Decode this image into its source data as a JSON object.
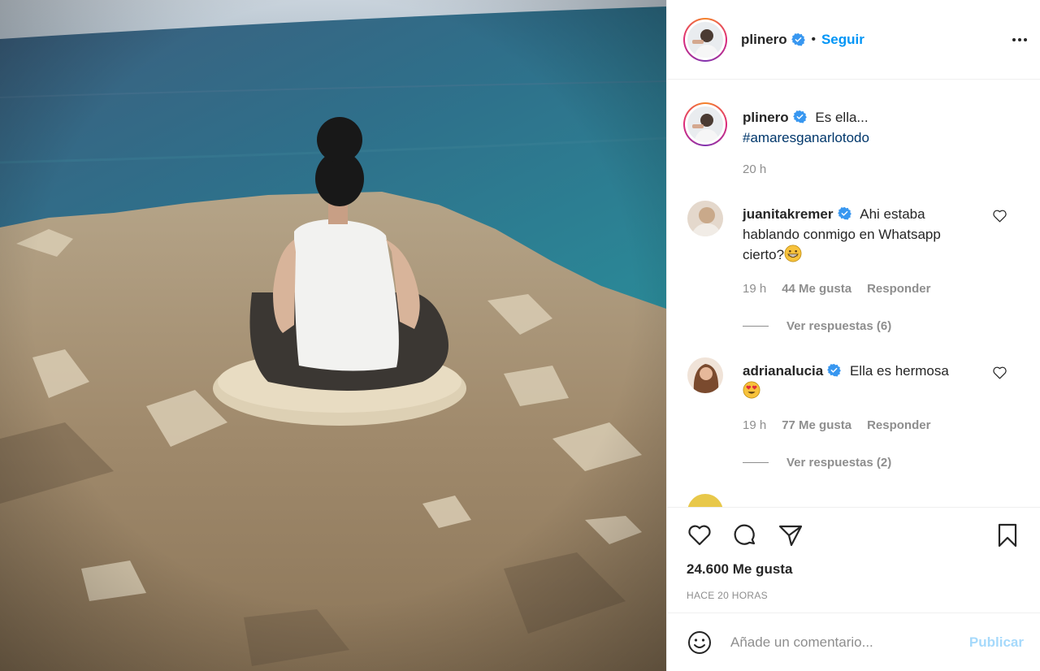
{
  "header": {
    "username": "plinero",
    "separator": "•",
    "follow_label": "Seguir",
    "more_icon": "more-horizontal-icon"
  },
  "caption": {
    "username": "plinero",
    "text": "Es ella...",
    "hashtag": "#amaresganarlotodo",
    "time": "20 h"
  },
  "comments": [
    {
      "username": "juanitakremer",
      "text": "Ahi estaba hablando conmigo en Whatsapp cierto?",
      "emoji_icon": "grinning-face-emoji",
      "time": "19 h",
      "likes": "44 Me gusta",
      "reply_label": "Responder",
      "view_replies": "Ver respuestas (6)"
    },
    {
      "username": "adrianalucia",
      "text": "Ella es hermosa",
      "emoji_icon": "heart-eyes-emoji",
      "time": "19 h",
      "likes": "77 Me gusta",
      "reply_label": "Responder",
      "view_replies": "Ver respuestas (2)"
    }
  ],
  "actions": {
    "like_icon": "heart-icon",
    "comment_icon": "comment-icon",
    "share_icon": "send-icon",
    "save_icon": "bookmark-icon",
    "likes_total": "24.600 Me gusta",
    "time_ago": "HACE 20 HORAS"
  },
  "add_comment": {
    "placeholder": "Añade un comentario...",
    "publish_label": "Publicar",
    "emoji_icon": "smiley-icon"
  },
  "colors": {
    "link_blue": "#0095f6",
    "hashtag_blue": "#00376b",
    "verified_blue": "#3897f0",
    "muted_text": "#8e8e8e"
  }
}
